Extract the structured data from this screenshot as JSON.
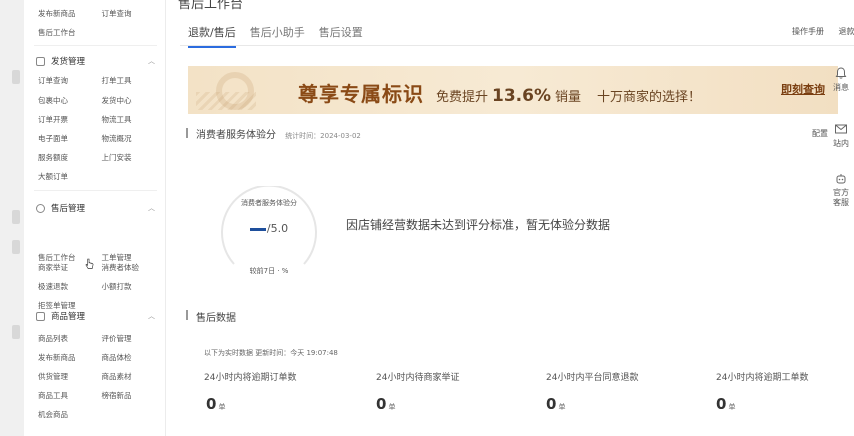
{
  "sidebar": {
    "top_rows": [
      [
        "发布新商品",
        "订单查询"
      ],
      [
        "售后工作台",
        ""
      ]
    ],
    "groups": [
      {
        "title": "发货管理",
        "rows": [
          [
            "订单查询",
            "打单工具"
          ],
          [
            "包裹中心",
            "发货中心"
          ],
          [
            "订单开票",
            "物流工具"
          ],
          [
            "电子面单",
            "物流概况"
          ],
          [
            "服务额度",
            "上门安装"
          ],
          [
            "大额订单",
            ""
          ]
        ]
      },
      {
        "title": "售后管理",
        "rows": [
          [
            "售后工作台",
            "工单管理"
          ],
          [
            "商家举证",
            "消费者体验"
          ],
          [
            "极速退款",
            "小额打款"
          ],
          [
            "拒签单管理",
            ""
          ]
        ]
      },
      {
        "title": "商品管理",
        "rows": [
          [
            "商品列表",
            "评价管理"
          ],
          [
            "发布新商品",
            "商品体检"
          ],
          [
            "供货管理",
            "商品素材"
          ],
          [
            "商品工具",
            "榜宿新品"
          ],
          [
            "机会商品",
            ""
          ]
        ]
      }
    ]
  },
  "header": {
    "title": "售后工作台",
    "tabs": [
      {
        "label": "退款/售后",
        "active": true
      },
      {
        "label": "售后小助手",
        "active": false
      },
      {
        "label": "售后设置",
        "active": false
      }
    ],
    "manual": "操作手册",
    "manual2": "退款"
  },
  "banner": {
    "headline": "尊享专属标识",
    "text1": "免费提升",
    "percent": "13.6%",
    "text2": "销量",
    "text3": "十万商家的选择！",
    "button": "即刻查询"
  },
  "right_tools": [
    {
      "label": "消息",
      "icon": "bell-icon"
    },
    {
      "label": "站内",
      "icon": "mail-icon"
    },
    {
      "label": "官方客服",
      "icon": "robot-icon"
    }
  ],
  "experience": {
    "title": "消费者服务体验分",
    "time_label": "统计时间：2024-03-02",
    "right_link": "配置",
    "score_label": "消费者服务体验分",
    "score_value": "/5.0",
    "compare": "较前7日 · %",
    "no_data": "因店铺经营数据未达到评分标准，暂无体验分数据"
  },
  "after_sales": {
    "title": "售后数据",
    "subtitle": "以下为实时数据   更新时间：今天 19:07:48",
    "metrics": [
      {
        "label": "24小时内将逾期订单数",
        "value": "0",
        "unit": "单"
      },
      {
        "label": "24小时内待商家举证",
        "value": "0",
        "unit": "单"
      },
      {
        "label": "24小时内平台同意退款",
        "value": "0",
        "unit": "单"
      },
      {
        "label": "24小时内将逾期工单数",
        "value": "0",
        "unit": "单"
      }
    ]
  },
  "colors": {
    "tab_active": "#2b6cdf",
    "score_dash": "#1e4f9c",
    "banner_bg": "#f3e2c6",
    "banner_text": "#8a4a16"
  }
}
